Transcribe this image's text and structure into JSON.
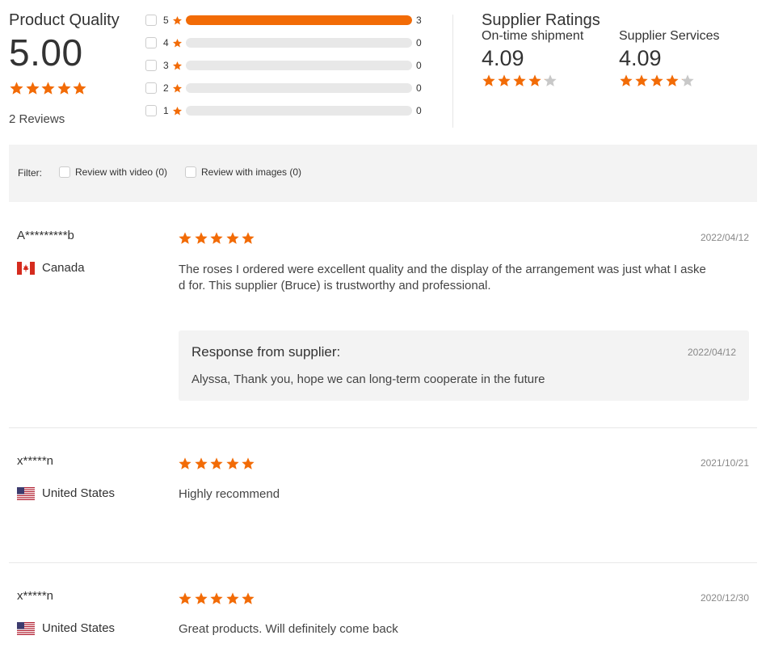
{
  "product_quality": {
    "title": "Product Quality",
    "score": "5.00",
    "stars": 5,
    "reviews_label": "2 Reviews"
  },
  "rating_breakdown": [
    {
      "star": "5",
      "count": "3",
      "fraction": 1.0
    },
    {
      "star": "4",
      "count": "0",
      "fraction": 0
    },
    {
      "star": "3",
      "count": "0",
      "fraction": 0
    },
    {
      "star": "2",
      "count": "0",
      "fraction": 0
    },
    {
      "star": "1",
      "count": "0",
      "fraction": 0
    }
  ],
  "supplier_ratings": {
    "title": "Supplier Ratings",
    "items": [
      {
        "label": "On-time shipment",
        "score": "4.09",
        "stars": 4.09
      },
      {
        "label": "Supplier Services",
        "score": "4.09",
        "stars": 4.09
      }
    ]
  },
  "filter": {
    "label": "Filter:",
    "options": [
      {
        "label": "Review with video (0)"
      },
      {
        "label": "Review with images (0)"
      }
    ]
  },
  "reviews": [
    {
      "user": "A*********b",
      "country": "Canada",
      "flag": "canada-flag-icon",
      "date": "2022/04/12",
      "stars": 5,
      "text_line1": "The roses I ordered were excellent quality and the display of the arrangement was just what I aske",
      "text_line2": "d for. This supplier (Bruce) is trustworthy and professional.",
      "response": {
        "title": "Response from supplier:",
        "date": "2022/04/12",
        "text": "Alyssa, Thank you, hope we can long-term cooperate in the future"
      }
    },
    {
      "user": "x*****n",
      "country": "United States",
      "flag": "us-flag-icon",
      "date": "2021/10/21",
      "stars": 5,
      "text_line1": "Highly recommend"
    },
    {
      "user": "x*****n",
      "country": "United States",
      "flag": "us-flag-icon",
      "date": "2020/12/30",
      "stars": 5,
      "text_line1": "Great products. Will definitely come back"
    }
  ],
  "colors": {
    "accent": "#f26b06",
    "star_empty": "#c8c8c8",
    "panel_bg": "#f3f3f3"
  }
}
